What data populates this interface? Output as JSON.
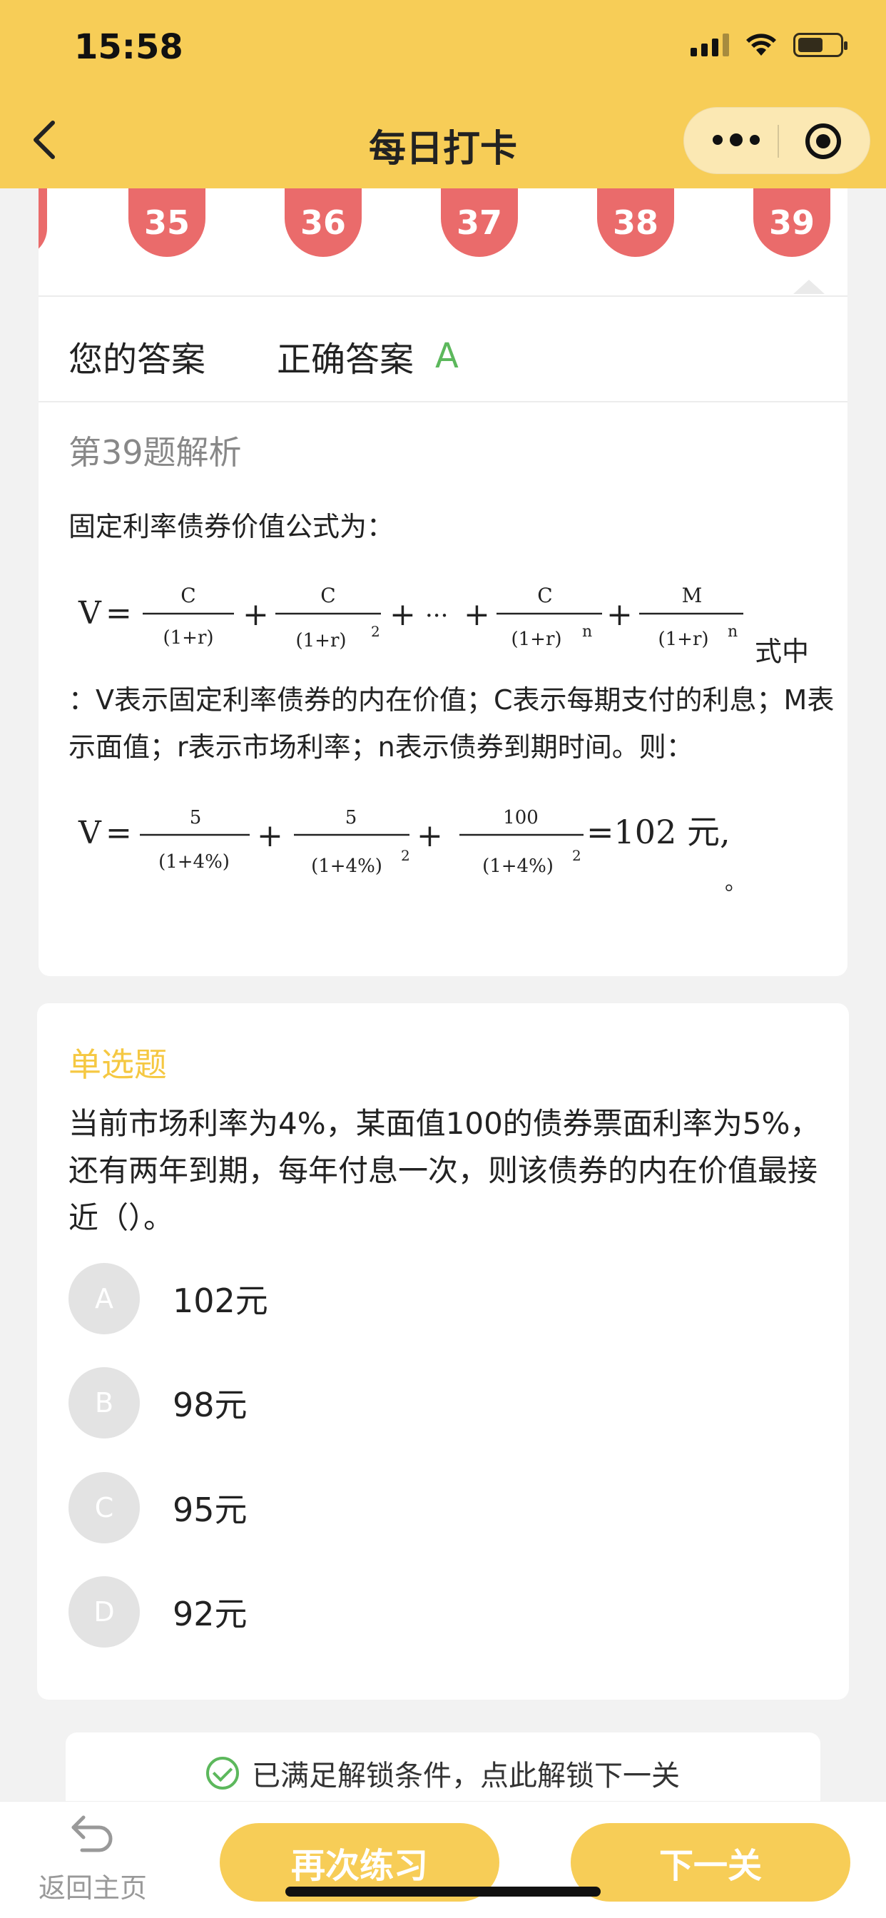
{
  "status_bar": {
    "time": "15:58"
  },
  "nav": {
    "title": "每日打卡"
  },
  "question_numbers": [
    "35",
    "36",
    "37",
    "38",
    "39"
  ],
  "answer": {
    "your_label": "您的答案",
    "correct_label": "正确答案",
    "correct_value": "A"
  },
  "analysis": {
    "title": "第39题解析",
    "intro": "固定利率债券价值公式为：",
    "formula_suffix": "式中",
    "explanation": "：V表示固定利率债券的内在价值；C表示每期支付的利息；M表示面值；r表示市场利率；n表示债券到期时间。则：",
    "period": "。"
  },
  "formula1": {
    "lhs": "V",
    "c": "C",
    "m": "M",
    "denom": "(1+r)",
    "exp2": "2",
    "expn": "n",
    "dots": "···"
  },
  "formula2": {
    "lhs": "V",
    "n5": "5",
    "n100": "100",
    "denom": "(1+4%)",
    "exp2": "2",
    "result": "=102 元,"
  },
  "question": {
    "type": "单选题",
    "text": "当前市场利率为4%，某面值100的债券票面利率为5%，还有两年到期，每年付息一次，则该债券的内在价值最接近（）。",
    "options": [
      {
        "letter": "A",
        "text": "102元"
      },
      {
        "letter": "B",
        "text": "98元"
      },
      {
        "letter": "C",
        "text": "95元"
      },
      {
        "letter": "D",
        "text": "92元"
      }
    ]
  },
  "unlock": {
    "text": "已满足解锁条件，点此解锁下一关"
  },
  "bottom": {
    "home_label": "返回主页",
    "retry_label": "再次练习",
    "next_label": "下一关"
  },
  "colors": {
    "brand_yellow": "#f7cd57",
    "number_red": "#ea6b6b",
    "correct_green": "#5cb85c",
    "option_gray": "#e3e3e3"
  }
}
